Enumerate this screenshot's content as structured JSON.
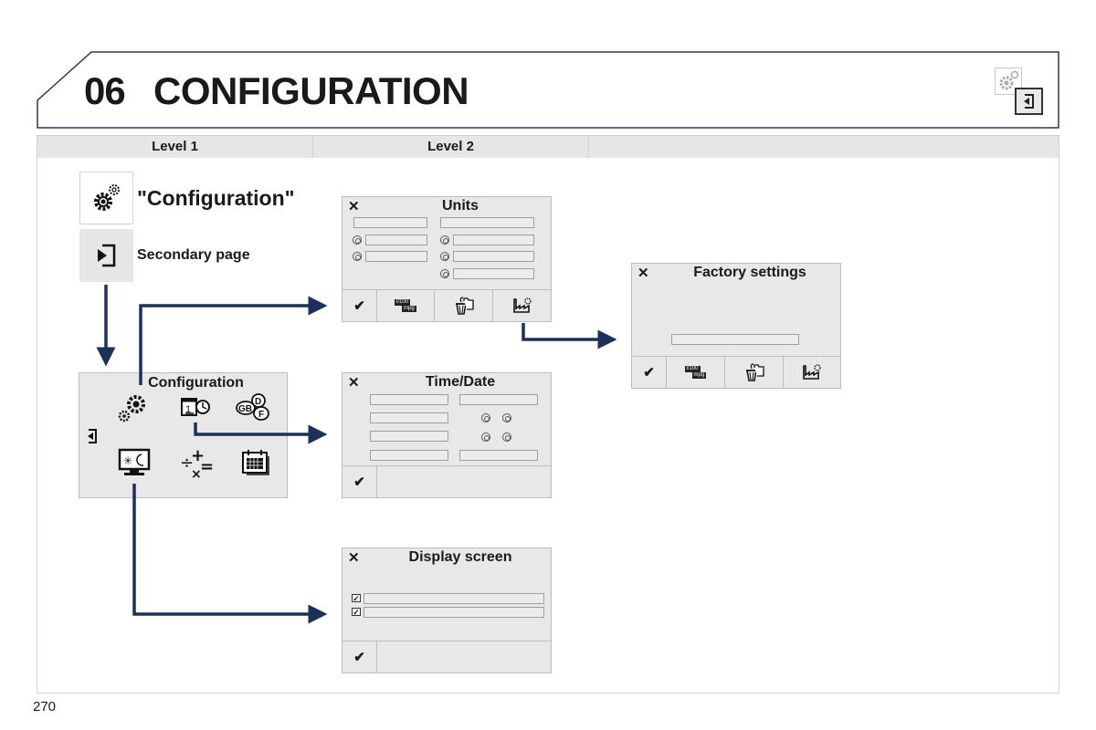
{
  "header": {
    "chapter_number": "06",
    "chapter_title": "CONFIGURATION"
  },
  "columns": [
    "Level 1",
    "Level 2",
    ""
  ],
  "level1": {
    "menu_label": "\"Configuration\"",
    "secondary_label": "Secondary page",
    "config_screen": {
      "title": "Configuration",
      "icons": [
        "gears-icon",
        "calendar-clock-icon",
        "language-icon",
        "display-day-night-icon",
        "calculator-icon",
        "calendar-icon"
      ]
    }
  },
  "panels": {
    "units": {
      "title": "Units",
      "toolbar": [
        "check-icon",
        "units-mpg-icon",
        "restore-icon",
        "factory-icon"
      ],
      "mpg_top": "l/100",
      "mpg_bottom": "mpg"
    },
    "factory": {
      "title": "Factory settings",
      "toolbar": [
        "check-icon",
        "units-mpg-icon",
        "restore-icon",
        "factory-icon"
      ],
      "mpg_top": "l/100",
      "mpg_bottom": "mpg"
    },
    "timedate": {
      "title": "Time/Date"
    },
    "display": {
      "title": "Display screen"
    }
  },
  "close_symbol": "✕",
  "check_symbol": "✔",
  "page_number": "270",
  "colors": {
    "arrow": "#1b3159",
    "panel_bg": "#e8e8e8",
    "header_bar": "#e6e6e6"
  }
}
